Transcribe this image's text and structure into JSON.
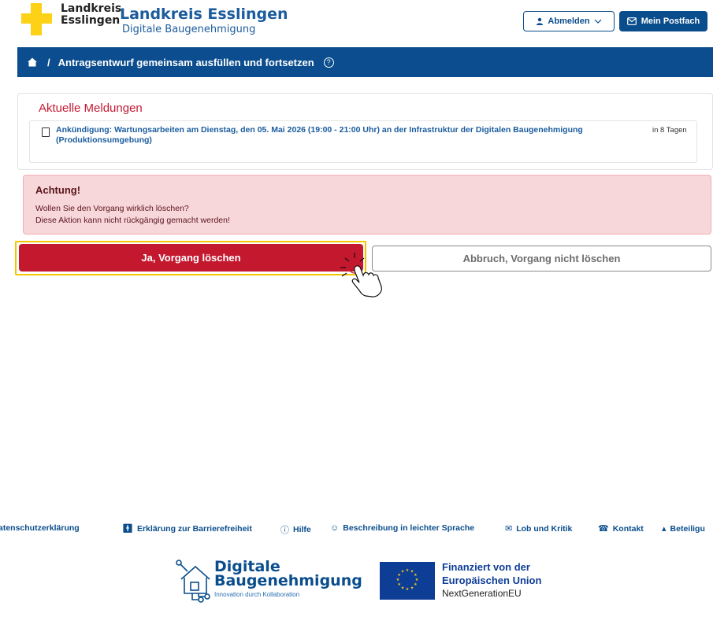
{
  "header": {
    "logo_line1": "Landkreis",
    "logo_line2": "Esslingen",
    "title": "Landkreis Esslingen",
    "subtitle": "Digitale Baugenehmigung",
    "logout_label": "Abmelden",
    "postfach_label": "Mein Postfach"
  },
  "breadcrumb": {
    "separator": "/",
    "current": "Antragsentwurf gemeinsam ausfüllen und fortsetzen",
    "help_glyph": "?"
  },
  "meldungen": {
    "title": "Aktuelle Meldungen",
    "items": [
      {
        "text": "Ankündigung: Wartungsarbeiten am Dienstag, den 05. Mai 2026 (19:00 - 21:00 Uhr) an der Infrastruktur der Digitalen Baugenehmigung (Produktionsumgebung)",
        "when": "in 8 Tagen"
      }
    ]
  },
  "alert": {
    "title": "Achtung!",
    "line1": "Wollen Sie den Vorgang wirklich löschen?",
    "line2": "Diese Aktion kann nicht rückgängig gemacht werden!"
  },
  "actions": {
    "confirm_label": "Ja, Vorgang löschen",
    "cancel_label": "Abbruch, Vorgang nicht löschen"
  },
  "footer": {
    "links": [
      {
        "label": "atenschutzerklärung",
        "icon": ""
      },
      {
        "label": "Erklärung zur Barrierefreiheit",
        "icon": "accessibility-icon"
      },
      {
        "label": "Hilfe",
        "icon": "help-icon"
      },
      {
        "label": "Beschreibung in leichter Sprache",
        "icon": "smiley-icon"
      },
      {
        "label": "Lob und Kritik",
        "icon": "envelope-open-icon"
      },
      {
        "label": "Kontakt",
        "icon": "phone-icon"
      },
      {
        "label": "Beteiligu",
        "icon": "person-icon"
      }
    ],
    "db_logo_line1": "Digitale",
    "db_logo_line2": "Baugenehmigung",
    "db_logo_sub": "Innovation durch Kollaboration",
    "eu_line1": "Finanziert von der",
    "eu_line2": "Europäischen Union",
    "eu_line3": "NextGenerationEU"
  },
  "colors": {
    "brand_blue": "#0b4d8e",
    "danger_red": "#c4182f",
    "logo_yellow": "#fcd116",
    "alert_bg": "#f8d7da",
    "focus_yellow": "#f3c400"
  }
}
